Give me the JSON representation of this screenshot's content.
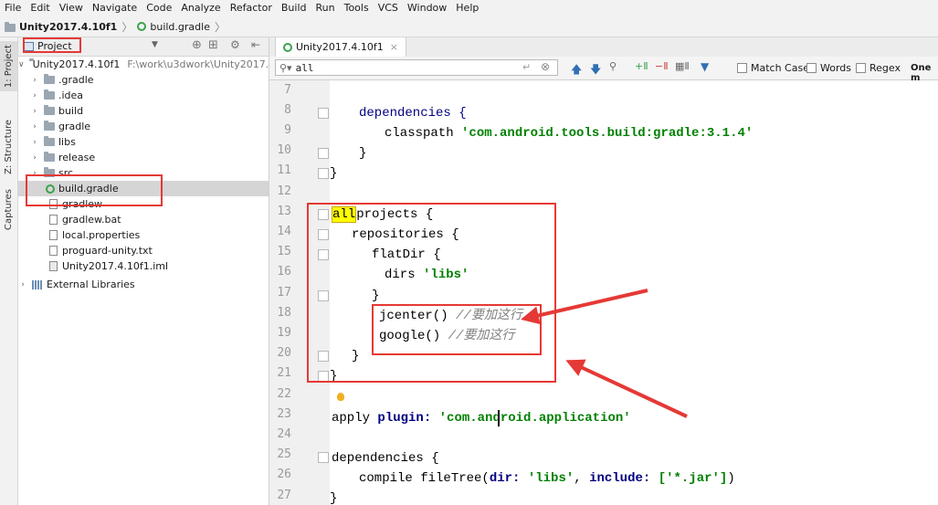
{
  "menu": [
    "File",
    "Edit",
    "View",
    "Navigate",
    "Code",
    "Analyze",
    "Refactor",
    "Build",
    "Run",
    "Tools",
    "VCS",
    "Window",
    "Help"
  ],
  "nav": {
    "project": "Unity2017.4.10f1",
    "file": "build.gradle"
  },
  "left_strip": {
    "project_tab": "1: Project",
    "structure_tab": "Z: Structure",
    "captures_tab": "Captures"
  },
  "project_panel": {
    "view_label": "Project",
    "root": {
      "name": "Unity2017.4.10f1",
      "path": "F:\\work\\u3dwork\\Unity2017.4.10"
    },
    "items": [
      {
        "name": ".gradle",
        "kind": "folder"
      },
      {
        "name": ".idea",
        "kind": "folder"
      },
      {
        "name": "build",
        "kind": "folder"
      },
      {
        "name": "gradle",
        "kind": "folder"
      },
      {
        "name": "libs",
        "kind": "folder"
      },
      {
        "name": "release",
        "kind": "folder"
      },
      {
        "name": "src",
        "kind": "folder"
      },
      {
        "name": "build.gradle",
        "kind": "gradle"
      },
      {
        "name": "gradlew",
        "kind": "file"
      },
      {
        "name": "gradlew.bat",
        "kind": "file"
      },
      {
        "name": "local.properties",
        "kind": "file"
      },
      {
        "name": "proguard-unity.txt",
        "kind": "file"
      },
      {
        "name": "Unity2017.4.10f1.iml",
        "kind": "file"
      }
    ],
    "external": "External Libraries"
  },
  "editor_tab": {
    "label": "Unity2017.4.10f1"
  },
  "search": {
    "query": "all",
    "match_case": "Match Case",
    "words": "Words",
    "regex": "Regex",
    "result": "One m"
  },
  "code": {
    "line_numbers": [
      "7",
      "8",
      "9",
      "10",
      "11",
      "12",
      "13",
      "14",
      "15",
      "16",
      "17",
      "18",
      "19",
      "20",
      "21",
      "22",
      "23",
      "24",
      "25",
      "26",
      "27"
    ],
    "l8_dependencies": "dependencies {",
    "l9_classpath": "classpath ",
    "l9_string": "'com.android.tools.build:gradle:3.1.4'",
    "close_brace": "}",
    "l13_match": "all",
    "l13_rest": "projects {",
    "l14": "repositories {",
    "l15": "flatDir {",
    "l16_dirs": "dirs ",
    "l16_string": "'libs'",
    "l18_call": "jcenter() ",
    "l18_comment": "//要加这行",
    "l19_call": "google() ",
    "l19_comment": "//要加这行",
    "l23_apply": "apply ",
    "l23_plugin": "plugin: ",
    "l23_string": "'com.android.application'",
    "l25": "dependencies {",
    "l26_compile": "compile fileTree(",
    "l26_dir": "dir: ",
    "l26_libs": "'libs'",
    "l26_comma": ", ",
    "l26_include": "include: ",
    "l26_list": "['*.jar']",
    "l26_close": ")"
  },
  "colors": {
    "annotation_red": "#e53935",
    "keyword": "#000080",
    "string": "#008000",
    "comment": "#808080",
    "match_highlight": "#ffff00"
  }
}
